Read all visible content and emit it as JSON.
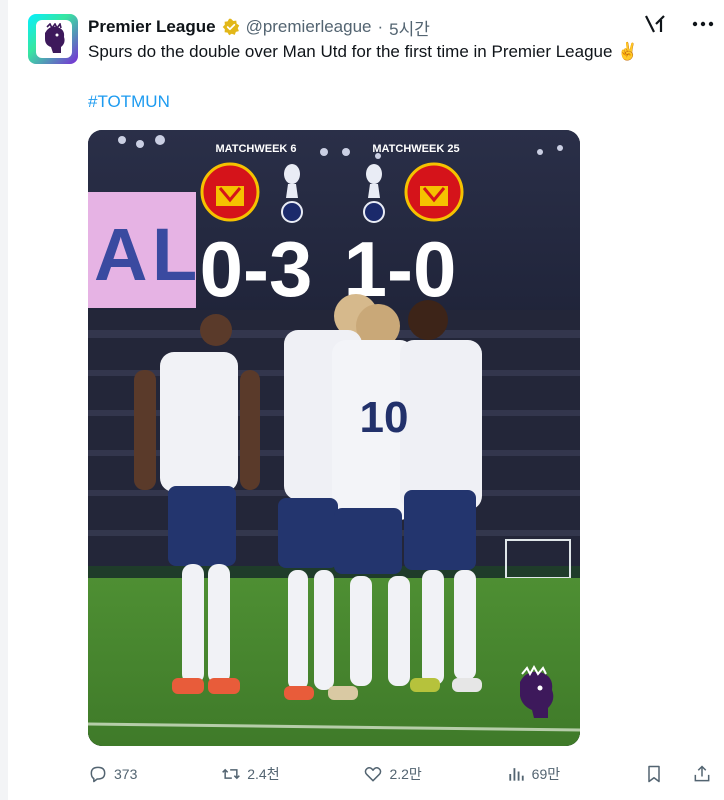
{
  "tweet": {
    "author_name": "Premier League",
    "handle": "@premierleague",
    "separator": "·",
    "time": "5시간",
    "text": "Spurs do the double over Man Utd for the first time in Premier League ✌️",
    "hashtag": "#TOTMUN"
  },
  "media": {
    "left_label": "MATCHWEEK 6",
    "right_label": "MATCHWEEK 25",
    "left_score": "0-3",
    "right_score": "1-0",
    "player_number": "10"
  },
  "actions": {
    "replies": "373",
    "reposts": "2.4천",
    "likes": "2.2만",
    "views": "69만"
  },
  "colors": {
    "link": "#1d9bf0",
    "text": "#0f1419",
    "muted": "#536471",
    "verified": "#e2b719"
  }
}
